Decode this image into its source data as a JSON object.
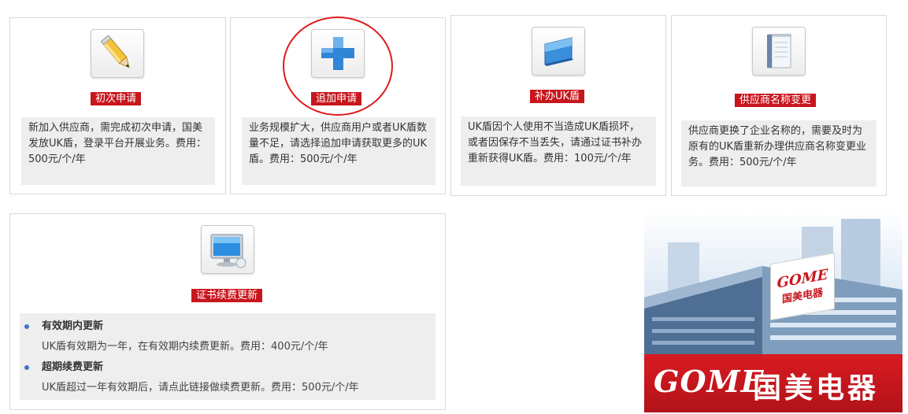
{
  "cards": [
    {
      "label": "初次申请",
      "icon": "pencil-icon",
      "desc": "新加入供应商，需完成初次申请，国美发放UK盾，登录平台开展业务。费用：500元/个/年"
    },
    {
      "label": "追加申请",
      "icon": "plus-icon",
      "desc": "业务规模扩大，供应商用户或者UK盾数量不足，请选择追加申请获取更多的UK盾。费用：500元/个/年"
    },
    {
      "label": "补办UK盾",
      "icon": "usb-key-icon",
      "desc": "UK盾因个人使用不当造成UK盾损坏，或者因保存不当丢失，请通过证书补办重新获得UK盾。费用：100元/个/年"
    },
    {
      "label": "供应商名称变更",
      "icon": "notebook-icon",
      "desc": "供应商更换了企业名称的，需要及时为原有的UK盾重新办理供应商名称变更业务。费用：500元/个/年"
    }
  ],
  "renew": {
    "label": "证书续费更新",
    "icon": "monitor-icon",
    "items": [
      {
        "title": "有效期内更新",
        "text": "UK盾有效期为一年，在有效期内续费更新。费用：400元/个/年"
      },
      {
        "title": "超期续费更新",
        "text": "UK盾超过一年有效期后，请点此链接做续费更新。费用：500元/个/年"
      }
    ]
  },
  "brand": {
    "logo": "GOME",
    "name": "国美电器",
    "color": "#c8161d"
  },
  "colors": {
    "accent": "#c8161d",
    "highlight_circle": "#e01a1a",
    "bullet": "#3f73c6"
  }
}
